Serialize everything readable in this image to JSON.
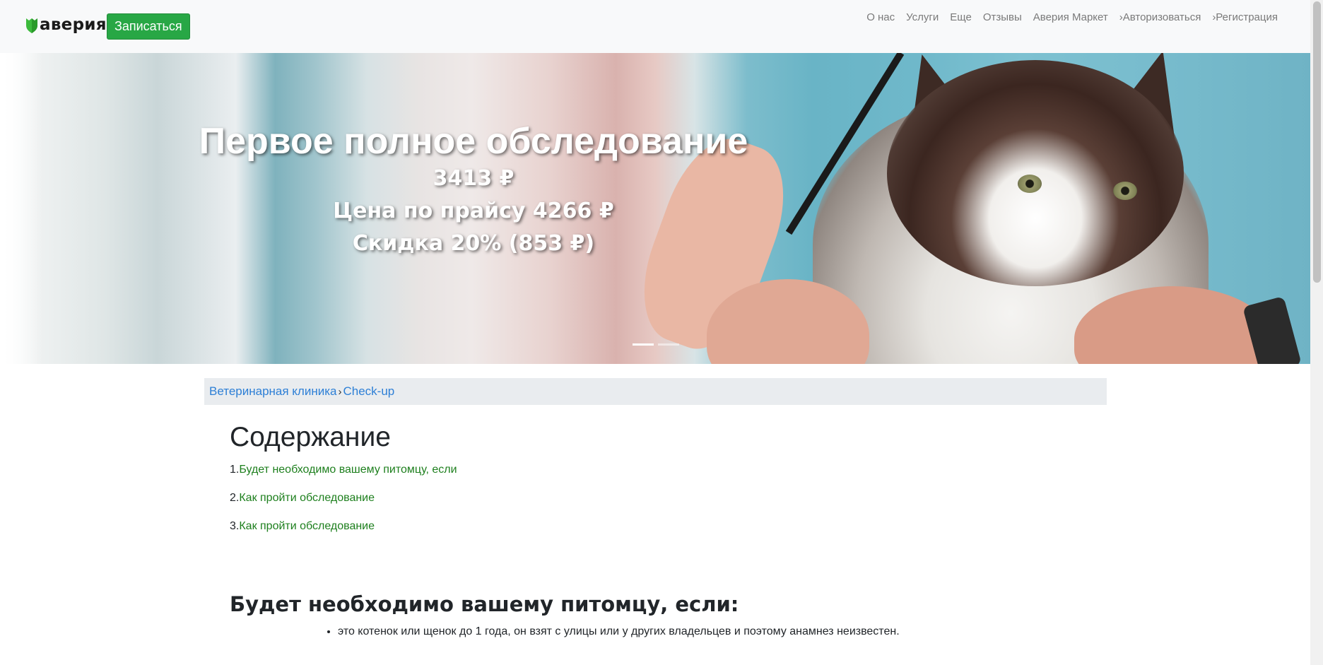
{
  "navbar": {
    "brand": "аверия",
    "signup_label": "Записаться",
    "links": [
      "О нас",
      "Услуги",
      "Еще",
      "Отзывы",
      "Аверия Маркет",
      "›Авторизоваться",
      "›Регистрация"
    ]
  },
  "hero": {
    "title": "Первое полное обследование",
    "price": "3413 ₽",
    "list_price": "Цена по прайсу 4266 ₽",
    "discount": "Скидка 20% (853 ₽)",
    "slides_count": 2,
    "active_slide": 1
  },
  "breadcrumb": {
    "home": "Ветеринарная клиника",
    "separator": "›",
    "current": "Check-up"
  },
  "toc": {
    "title": "Содержание",
    "items": [
      {
        "num": "1.",
        "label": "Будет необходимо вашему питомцу, если"
      },
      {
        "num": "2.",
        "label": "Как пройти обследование"
      },
      {
        "num": "3.",
        "label": "Как пройти обследование"
      }
    ]
  },
  "section": {
    "title": "Будет необходимо вашему питомцу, если:",
    "bullets": [
      "это котенок или щенок до 1 года, он взят с улицы или у других владельцев и поэтому анамнез неизвестен."
    ]
  },
  "colors": {
    "brand_green": "#28a745",
    "link_green": "#1d7f1d",
    "link_blue": "#2d7fd6"
  }
}
